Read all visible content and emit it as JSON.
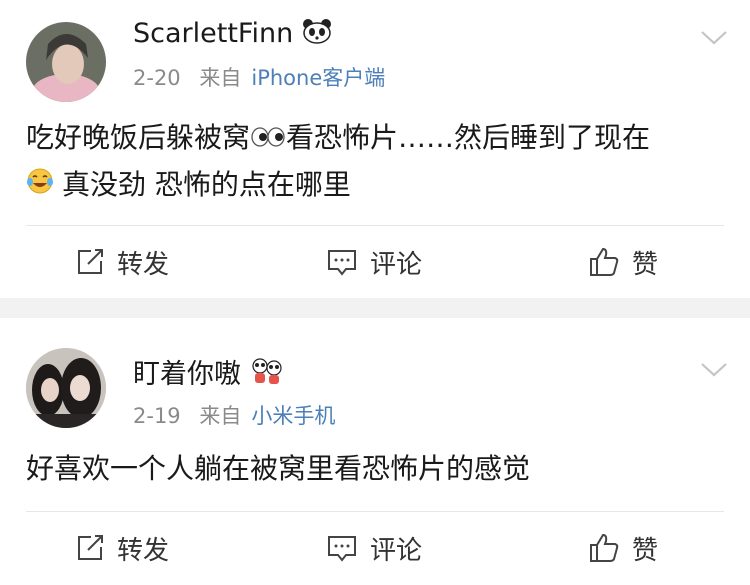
{
  "posts": [
    {
      "username": "ScarlettFinn",
      "date": "2-20",
      "source_prefix": "来自",
      "source": "iPhone客户端",
      "text_line1a": "吃好晚饭后躲被窝",
      "text_line1b": "看恐怖片……然后睡到了现在",
      "text_line2": "真没劲 恐怖的点在哪里",
      "actions": {
        "repost": "转发",
        "comment": "评论",
        "like": "赞"
      }
    },
    {
      "username": "盯着你嗷",
      "date": "2-19",
      "source_prefix": "来自",
      "source": "小米手机",
      "text": "好喜欢一个人躺在被窝里看恐怖片的感觉",
      "actions": {
        "repost": "转发",
        "comment": "评论",
        "like": "赞"
      }
    }
  ],
  "colors": {
    "source_link": "#4d7fb8",
    "meta_gray": "#8a8a8a",
    "divider": "#f2f2f2"
  },
  "icons": [
    "panda-badge-icon",
    "eyes-emoji-icon",
    "laughing-tears-emoji-icon",
    "panda-pair-badge-icon",
    "chevron-down-icon",
    "repost-icon",
    "comment-icon",
    "like-icon"
  ]
}
